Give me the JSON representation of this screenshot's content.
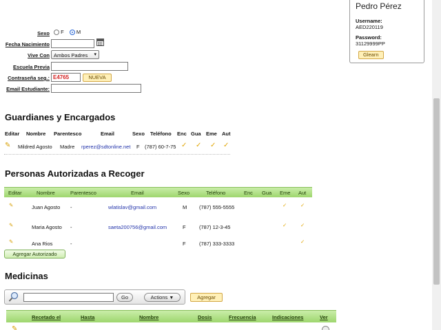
{
  "user": {
    "name": "Pedro Pérez",
    "username_label": "Username:",
    "username": "AED220119",
    "password_label": "Password:",
    "password": "31129999PP",
    "button": "Glearn"
  },
  "form": {
    "sexo_label": "Sexo",
    "sexo_f": "F",
    "sexo_m": "M",
    "fecha_label": "Fecha Nacimiento",
    "vive_label": "Vive Con",
    "vive_value": "Ambos Padres",
    "escuela_label": "Escuela Previa",
    "contrasena_label": "Contraseña seg.:",
    "contrasena_value": "E4765",
    "nueva_button": "NUEVA",
    "email_label": "Email Estudiante:"
  },
  "guardianes": {
    "title": "Guardianes y Encargados",
    "headers": [
      "Editar",
      "Nombre",
      "Parentesco",
      "Email",
      "Sexo",
      "Teléfono",
      "Enc",
      "Gua",
      "Eme",
      "Aut"
    ],
    "row": {
      "nombre": "Mildred Agosto",
      "parentesco": "Madre",
      "email": "rperez@sdtonline.net",
      "sexo": "F",
      "telefono": "(787) 60-7-75"
    }
  },
  "personas": {
    "title": "Personas Autorizadas a Recoger",
    "headers": [
      "Editar",
      "Nombre",
      "Parentesco",
      "Email",
      "Sexo",
      "Teléfono",
      "Enc",
      "Gua",
      "Eme",
      "Aut"
    ],
    "rows": [
      {
        "nombre": "Juan Agosto",
        "parentesco": "-",
        "email": "wlatislav@gmail.com",
        "sexo": "M",
        "telefono": "(787) 555-5555"
      },
      {
        "nombre": "Maria Agosto",
        "parentesco": "-",
        "email": "saeta200756@gmail.com",
        "sexo": "F",
        "telefono": "(787) 12-3-45"
      },
      {
        "nombre": "Ana Rios",
        "parentesco": "-",
        "email": "",
        "sexo": "F",
        "telefono": "(787) 333-3333"
      }
    ],
    "add_button": "Agregar Autorizado"
  },
  "medicinas": {
    "title": "Medicinas",
    "go_button": "Go",
    "actions_button": "Actions",
    "agregar_button": "Agregar",
    "headers": [
      "Recetado el",
      "Hasta",
      "Nombre",
      "Dosis",
      "Frecuencia",
      "Indicaciones",
      "Ver"
    ]
  },
  "colors": {
    "grid_header": "#9ed66e",
    "check": "#e0a400",
    "link": "#2233aa",
    "password_red": "#d42020"
  }
}
